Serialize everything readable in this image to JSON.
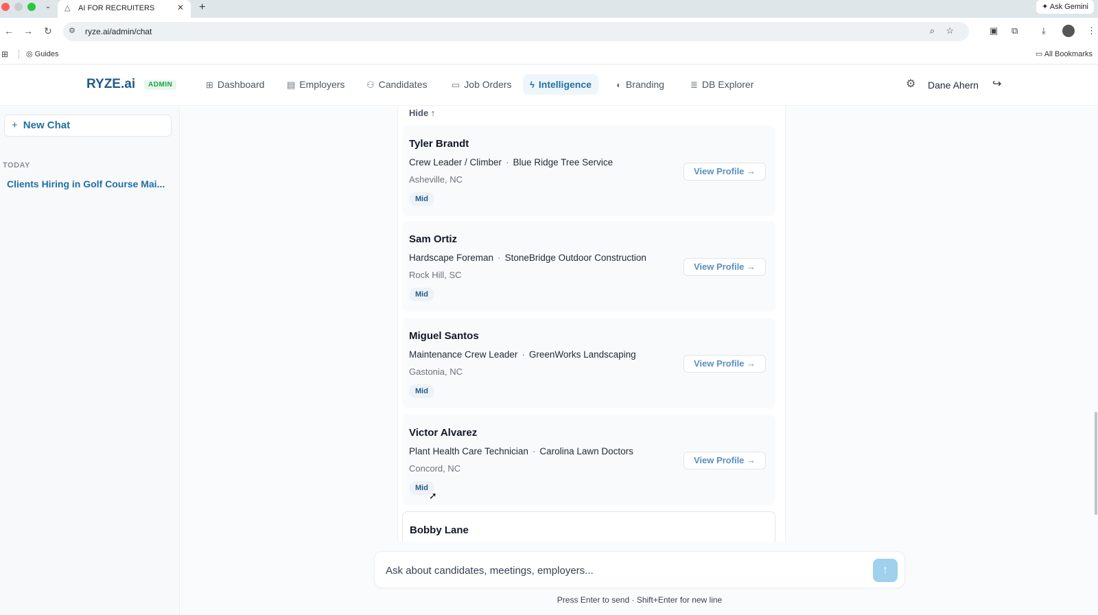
{
  "browser": {
    "tab_title": "AI FOR RECRUITERS",
    "tab_close": "✕",
    "new_tab": "+",
    "ask_gemini": "Ask Gemini",
    "url": "ryze.ai/admin/chat",
    "bookmark_guides": "Guides",
    "all_bookmarks": "All Bookmarks"
  },
  "header": {
    "logo": "RYZE.ai",
    "badge": "ADMIN",
    "nav": [
      {
        "label": "Dashboard",
        "icon": "grid-icon"
      },
      {
        "label": "Employers",
        "icon": "building-icon"
      },
      {
        "label": "Candidates",
        "icon": "users-icon"
      },
      {
        "label": "Job Orders",
        "icon": "briefcase-icon"
      },
      {
        "label": "Intelligence",
        "icon": "bolt-icon",
        "active": true
      },
      {
        "label": "Branding",
        "icon": "palette-icon"
      },
      {
        "label": "DB Explorer",
        "icon": "database-icon"
      }
    ],
    "user_name": "Dane Ahern"
  },
  "sidebar": {
    "new_chat": "New Chat",
    "section_label": "TODAY",
    "chats": [
      {
        "title": "Clients Hiring in Golf Course Mai..."
      }
    ]
  },
  "results": {
    "hide_label": "Hide ↑",
    "view_profile_label": "View Profile →",
    "candidates": [
      {
        "name": "Tyler Brandt",
        "title": "Crew Leader / Climber",
        "company": "Blue Ridge Tree Service",
        "location": "Asheville, NC",
        "level": "Mid"
      },
      {
        "name": "Sam Ortiz",
        "title": "Hardscape Foreman",
        "company": "StoneBridge Outdoor Construction",
        "location": "Rock Hill, SC",
        "level": "Mid"
      },
      {
        "name": "Miguel Santos",
        "title": "Maintenance Crew Leader",
        "company": "GreenWorks Landscaping",
        "location": "Gastonia, NC",
        "level": "Mid"
      },
      {
        "name": "Victor Alvarez",
        "title": "Plant Health Care Technician",
        "company": "Carolina Lawn Doctors",
        "location": "Concord, NC",
        "level": "Mid"
      },
      {
        "name": "Bobby Lane"
      }
    ]
  },
  "composer": {
    "placeholder": "Ask about candidates, meetings, employers...",
    "send": "↑",
    "hint": "Press Enter to send · Shift+Enter for new line"
  },
  "colors": {
    "brand": "#1f5a8a",
    "accent": "#1f6fa3",
    "admin_badge": "#16a34a",
    "send_button": "#9fd0ec"
  }
}
